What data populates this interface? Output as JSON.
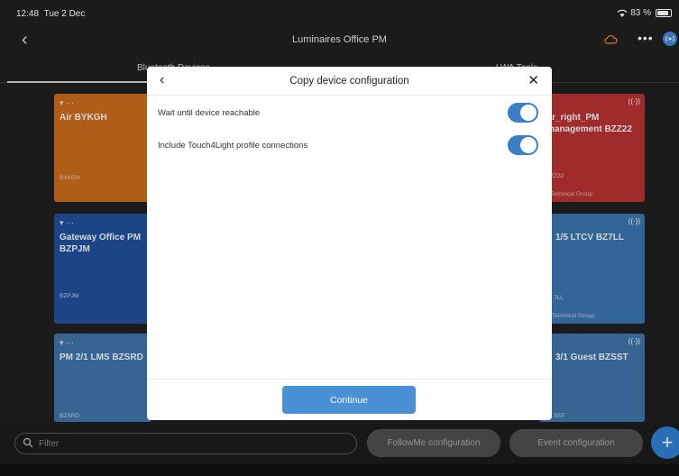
{
  "status_bar": {
    "time": "12:48",
    "date": "Tue 2 Dec",
    "battery": "83 %",
    "battery_level": 0.83
  },
  "navbar": {
    "title": "Luminaires Office PM"
  },
  "tabs": [
    {
      "label": "Bluetooth Devices"
    },
    {
      "label": "LWA Tools"
    }
  ],
  "tiles": [
    {
      "name": "Air BYKGH",
      "sub": "BYKGH",
      "group": ""
    },
    {
      "name": "or_right_PM\nmanagement BZZ22",
      "sub": "ZZ22",
      "group": "Technical Group"
    },
    {
      "name": "Gateway Office PM\nBZPJM",
      "sub": "BZPJM",
      "group": ""
    },
    {
      "name": "1/5 LTCV BZ7LL",
      "sub": "7LL",
      "group": "Technical Group"
    },
    {
      "name": "PM 2/1 LMS BZSRD",
      "sub": "BZSRD",
      "group": ""
    },
    {
      "name": "3/1 Guest BZSST",
      "sub": "SST",
      "group": ""
    }
  ],
  "bottom_bar": {
    "filter_placeholder": "Filter",
    "followme_label": "FollowMe configuration",
    "event_label": "Event configuration",
    "add_label": "+"
  },
  "dialog": {
    "title": "Copy device configuration",
    "options": [
      {
        "label": "Wait until device reachable",
        "enabled": true
      },
      {
        "label": "Include Touch4Light profile connections",
        "enabled": true
      }
    ],
    "continue_label": "Continue"
  },
  "colors": {
    "accent": "#3b7fc4",
    "continue_button": "#4a90d6",
    "tile_orange": "#c96a1c",
    "tile_red": "#b63232",
    "tile_blue": "#1f4f99"
  },
  "icons": [
    "back-chevron-icon",
    "cloud-icon",
    "more-icon",
    "signal-icon",
    "wifi-icon",
    "search-icon",
    "close-icon",
    "plus-icon"
  ]
}
